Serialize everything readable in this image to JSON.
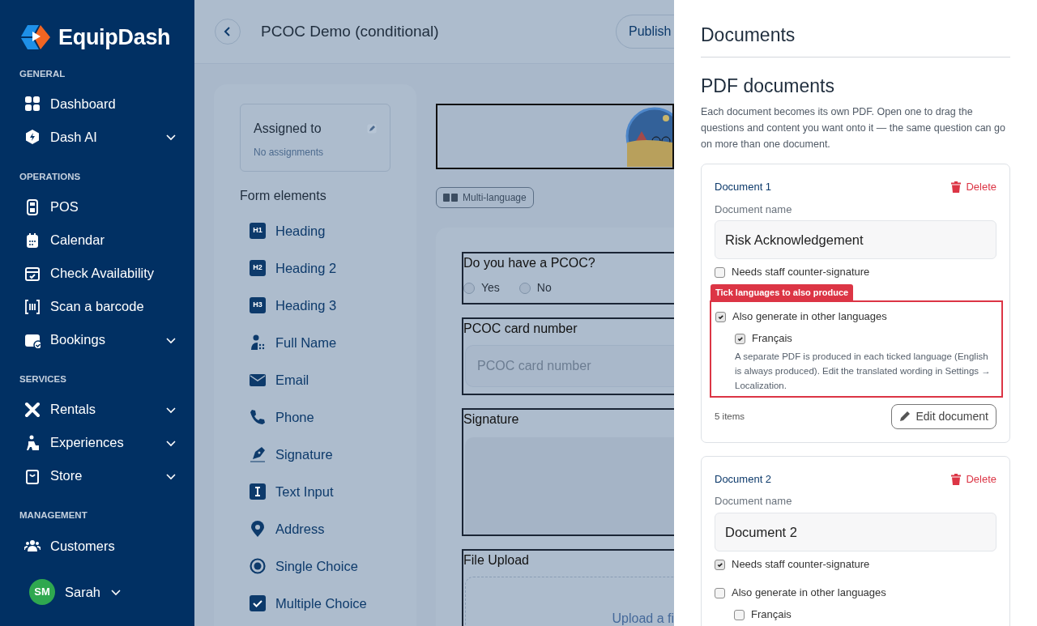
{
  "sidebar": {
    "brand": "EquipDash",
    "sections": [
      {
        "title": "GENERAL",
        "items": [
          {
            "label": "Dashboard",
            "expandable": false
          },
          {
            "label": "Dash AI",
            "expandable": true
          }
        ]
      },
      {
        "title": "OPERATIONS",
        "items": [
          {
            "label": "POS",
            "expandable": false
          },
          {
            "label": "Calendar",
            "expandable": false
          },
          {
            "label": "Check Availability",
            "expandable": false
          },
          {
            "label": "Scan a barcode",
            "expandable": false
          },
          {
            "label": "Bookings",
            "expandable": true
          }
        ]
      },
      {
        "title": "SERVICES",
        "items": [
          {
            "label": "Rentals",
            "expandable": true
          },
          {
            "label": "Experiences",
            "expandable": true
          },
          {
            "label": "Store",
            "expandable": true
          }
        ]
      },
      {
        "title": "MANAGEMENT",
        "items": [
          {
            "label": "Customers",
            "expandable": false
          }
        ]
      }
    ],
    "user": {
      "initials": "SM",
      "name": "Sarah"
    }
  },
  "header": {
    "title": "PCOC Demo (conditional)",
    "publish_button": "Publish"
  },
  "assigned": {
    "title": "Assigned to",
    "value": "No assignments"
  },
  "form_elements": {
    "title": "Form elements",
    "items": [
      {
        "label": "Heading",
        "badge": "H1"
      },
      {
        "label": "Heading 2",
        "badge": "H2"
      },
      {
        "label": "Heading 3",
        "badge": "H3"
      },
      {
        "label": "Full Name"
      },
      {
        "label": "Email"
      },
      {
        "label": "Phone"
      },
      {
        "label": "Signature"
      },
      {
        "label": "Text Input"
      },
      {
        "label": "Address"
      },
      {
        "label": "Single Choice"
      },
      {
        "label": "Multiple Choice"
      }
    ]
  },
  "multi_language_chip": "Multi-language",
  "questions": [
    {
      "kind": "radio",
      "label": "Do you have a PCOC?",
      "options": [
        {
          "label": "Yes",
          "selected": false
        },
        {
          "label": "No",
          "selected": false
        }
      ]
    },
    {
      "kind": "text",
      "label": "PCOC card number",
      "placeholder": "PCOC card number"
    },
    {
      "kind": "signature",
      "label": "Signature"
    },
    {
      "kind": "upload",
      "label": "File Upload",
      "prompt": "Upload a fi"
    }
  ],
  "panel": {
    "title": "Documents",
    "section_title": "PDF documents",
    "description": "Each document becomes its own PDF. Open one to drag the questions and content you want onto it — the same question can go on more than one document.",
    "documents": [
      {
        "heading": "Document 1",
        "delete": "Delete",
        "name_label": "Document name",
        "name_value": "Risk Acknowledgement",
        "counter_signature": {
          "label": "Needs staff counter-signature",
          "checked": false
        },
        "languages": {
          "label": "Also generate in other languages",
          "checked": true,
          "options": [
            {
              "label": "Français",
              "checked": true
            }
          ],
          "note": "A separate PDF is produced in each ticked language (English is always produced). Edit the translated wording in Settings → Localization."
        },
        "highlight_tag": "Tick languages to also produce",
        "item_count": "5 items",
        "edit_button": "Edit document"
      },
      {
        "heading": "Document 2",
        "delete": "Delete",
        "name_label": "Document name",
        "name_value": "Document 2",
        "counter_signature": {
          "label": "Needs staff counter-signature",
          "checked": true
        },
        "languages": {
          "label": "Also generate in other languages",
          "checked": false,
          "options": [
            {
              "label": "Français",
              "checked": false
            }
          ]
        }
      }
    ]
  }
}
